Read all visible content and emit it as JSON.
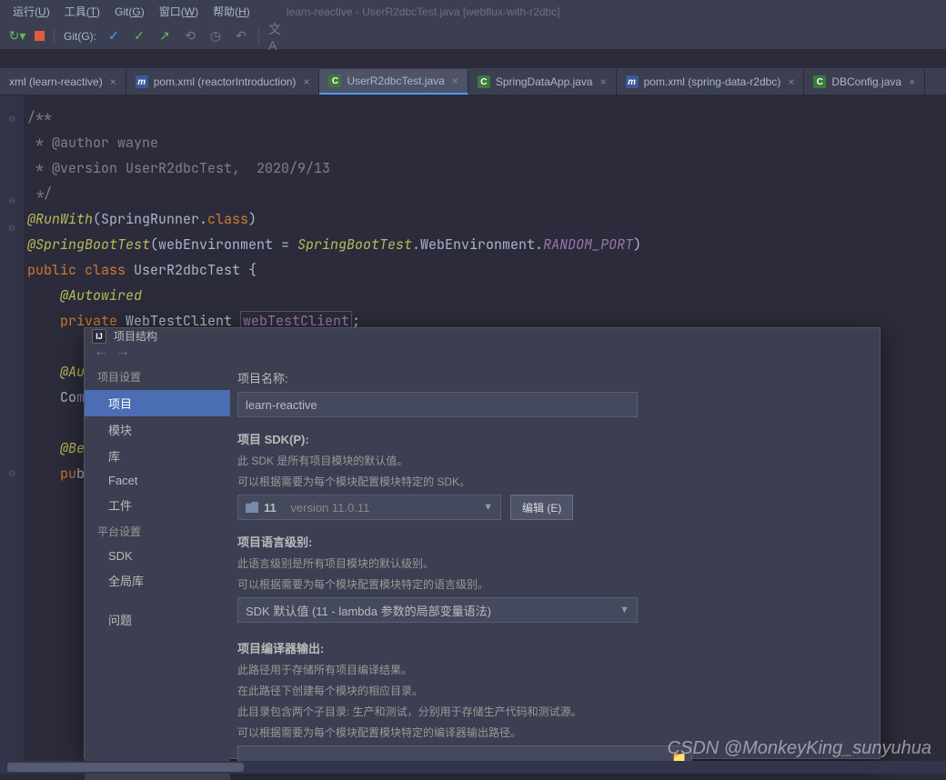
{
  "menubar": {
    "items": [
      {
        "label": "运行",
        "key": "U"
      },
      {
        "label": "工具",
        "key": "T"
      },
      {
        "label": "Git",
        "key": "G"
      },
      {
        "label": "窗口",
        "key": "W"
      },
      {
        "label": "帮助",
        "key": "H"
      }
    ],
    "window_title": "learn-reactive - UserR2dbcTest.java [webflux-with-r2dbc]"
  },
  "toolbar": {
    "git_label": "Git(G):"
  },
  "tabs": [
    {
      "label": "xml (learn-reactive)",
      "icon": "",
      "color": "",
      "active": false
    },
    {
      "label": "pom.xml (reactorIntroduction)",
      "icon": "m",
      "color": "m-icon",
      "active": false
    },
    {
      "label": "UserR2dbcTest.java",
      "icon": "C",
      "color": "c-icon",
      "active": true
    },
    {
      "label": "SpringDataApp.java",
      "icon": "C",
      "color": "c-icon",
      "active": false
    },
    {
      "label": "pom.xml (spring-data-r2dbc)",
      "icon": "m",
      "color": "m-icon",
      "active": false
    },
    {
      "label": "DBConfig.java",
      "icon": "C",
      "color": "c-icon",
      "active": false
    }
  ],
  "code": {
    "l1": "/**",
    "l2": " * @author wayne",
    "l3": " * @version UserR2dbcTest,  2020/9/13",
    "l4": " */",
    "l5a": "@RunWith",
    "l5b": "(SpringRunner.",
    "l5c": "class",
    "l5d": ")",
    "l6a": "@SpringBootTest",
    "l6b": "(webEnvironment = ",
    "l6c": "SpringBootTest",
    "l6d": ".WebEnvironment.",
    "l6e": "RANDOM_PORT",
    "l6f": ")",
    "l7a": "public class ",
    "l7b": "UserR2dbcTest ",
    "l7c": "{",
    "l8a": "@Autowired",
    "l9a": "private ",
    "l9b": "WebTestClient ",
    "l9c": "webTestClient",
    "l9d": ";",
    "l10a": "@Au",
    "l11a": "Co",
    "l11b": "m",
    "l12a": "@Be",
    "l13a": "pu",
    "l13b": "b"
  },
  "dialog": {
    "title": "项目结构",
    "sidebar": {
      "sections": [
        {
          "title": "项目设置",
          "items": [
            {
              "label": "项目",
              "sel": true
            },
            {
              "label": "模块",
              "sel": false
            },
            {
              "label": "库",
              "sel": false
            },
            {
              "label": "Facet",
              "sel": false
            },
            {
              "label": "工件",
              "sel": false
            }
          ]
        },
        {
          "title": "平台设置",
          "items": [
            {
              "label": "SDK",
              "sel": false
            },
            {
              "label": "全局库",
              "sel": false
            }
          ]
        },
        {
          "title": "",
          "items": [
            {
              "label": "问题",
              "sel": false
            }
          ]
        }
      ]
    },
    "main": {
      "project_name_label": "项目名称:",
      "project_name_value": "learn-reactive",
      "sdk_label": "项目 SDK(P):",
      "sdk_hint1": "此 SDK 是所有项目模块的默认值。",
      "sdk_hint2": "可以根据需要为每个模块配置模块特定的 SDK。",
      "sdk_value": "11",
      "sdk_version": "version 11.0.11",
      "edit_button": "编辑 (E)",
      "lang_label": "项目语言级别:",
      "lang_hint1": "此语言级别是所有项目模块的默认级别。",
      "lang_hint2": "可以根据需要为每个模块配置模块特定的语言级别。",
      "lang_value": "SDK 默认值 (11 - lambda 参数的局部变量语法)",
      "out_label": "项目编译器输出:",
      "out_hint1": "此路径用于存储所有项目编译结果。",
      "out_hint2": "在此路径下创建每个模块的相应目录。",
      "out_hint3": "此目录包含两个子目录: 生产和测试，分别用于存储生产代码和测试源。",
      "out_hint4": "可以根据需要为每个模块配置模块特定的编译器输出路径。",
      "out_value": ""
    }
  },
  "watermark": "CSDN @MonkeyKing_sunyuhua"
}
